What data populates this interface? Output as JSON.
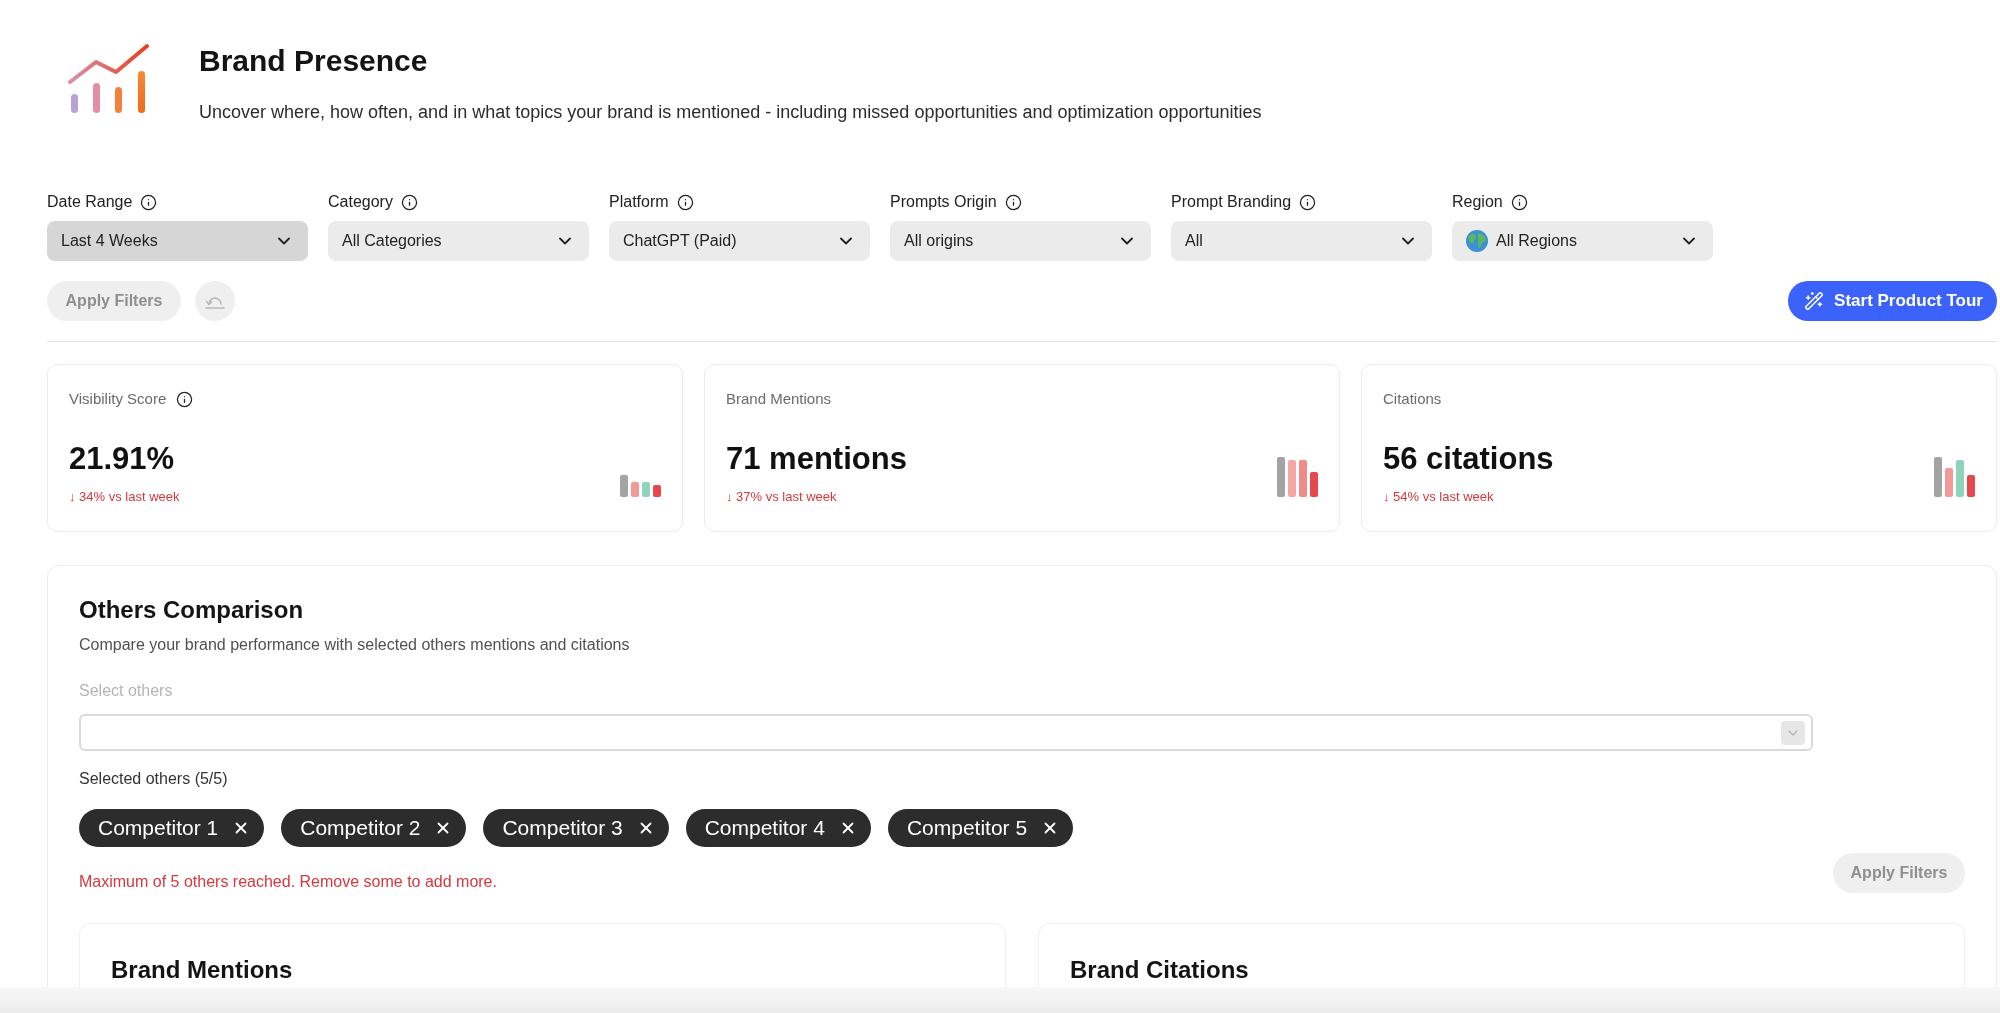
{
  "header": {
    "title": "Brand Presence",
    "subtitle": "Uncover where, how often, and in what topics your brand is mentioned - including missed opportunities and optimization opportunities"
  },
  "filters": [
    {
      "label": "Date Range",
      "value": "Last 4 Weeks",
      "kind": "plain",
      "focused": true
    },
    {
      "label": "Category",
      "value": "All Categories",
      "kind": "plain",
      "focused": false
    },
    {
      "label": "Platform",
      "value": "ChatGPT (Paid)",
      "kind": "plain",
      "focused": false
    },
    {
      "label": "Prompts Origin",
      "value": "All origins",
      "kind": "plain",
      "focused": false
    },
    {
      "label": "Prompt Branding",
      "value": "All",
      "kind": "plain",
      "focused": false
    },
    {
      "label": "Region",
      "value": "All Regions",
      "kind": "globe",
      "focused": false
    }
  ],
  "filter_actions": {
    "apply": {
      "label": "Apply Filters",
      "disabled": true
    },
    "start_tour": {
      "label": "Start Product Tour"
    }
  },
  "metrics": [
    {
      "label": "Visibility Score",
      "info": true,
      "value": "21.91%",
      "change": "↓ 34% vs last week"
    },
    {
      "label": "Brand Mentions",
      "info": false,
      "value": "71 mentions",
      "change": "↓ 37% vs last week"
    },
    {
      "label": "Citations",
      "info": false,
      "value": "56 citations",
      "change": "↓ 54% vs last week"
    }
  ],
  "comparison": {
    "title": "Others Comparison",
    "subtitle": "Compare your brand performance with selected others mentions and citations",
    "select": {
      "label": "Select others",
      "disabled": true
    },
    "selected_label": "Selected others (5/5)",
    "chips": [
      {
        "label": "Competitor 1"
      },
      {
        "label": "Competitor 2"
      },
      {
        "label": "Competitor 3"
      },
      {
        "label": "Competitor 4"
      },
      {
        "label": "Competitor 5"
      }
    ],
    "error": "Maximum of 5 others reached. Remove some to add more.",
    "apply": {
      "label": "Apply Filters",
      "disabled": true
    },
    "panels": [
      {
        "title": "Brand Mentions"
      },
      {
        "title": "Brand Citations"
      }
    ]
  }
}
